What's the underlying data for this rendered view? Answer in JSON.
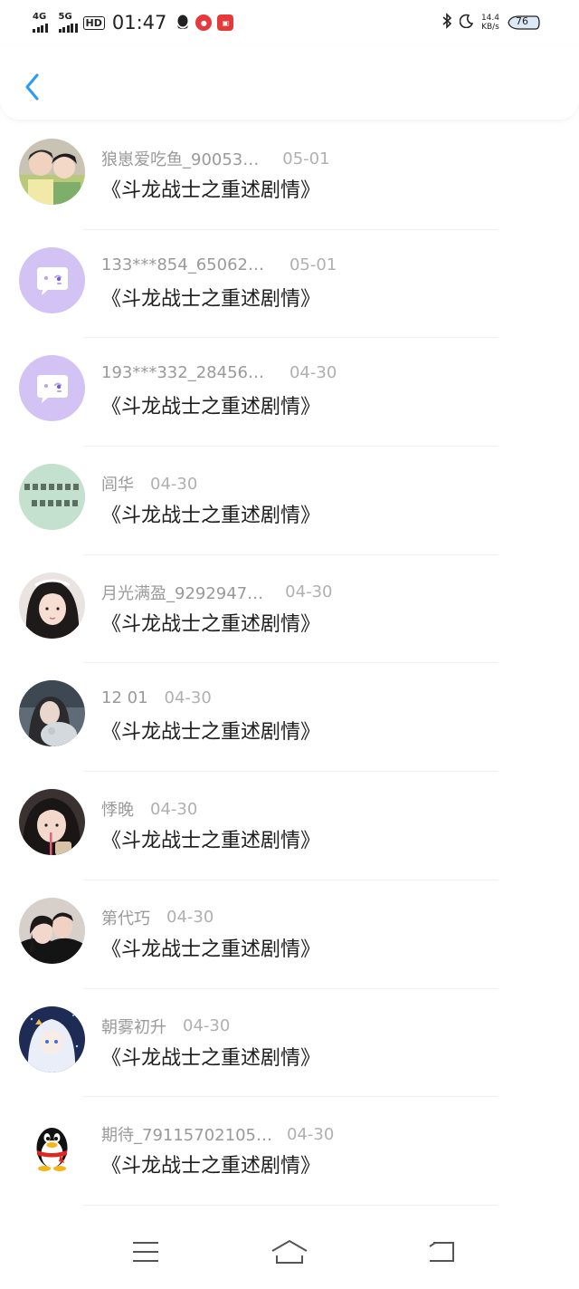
{
  "status_bar": {
    "network_1": "4G",
    "network_2": "5G",
    "hd_label": "HD",
    "time": "01:47",
    "net_speed_value": "14.4",
    "net_speed_unit": "KB/s",
    "battery_level": "76"
  },
  "header": {
    "back_icon": "chevron-left-icon"
  },
  "comments": [
    {
      "username": "狼崽爱吃鱼_90053…",
      "date": "05-01",
      "title": "《斗龙战士之重述剧情》",
      "avatar": "photo-two-boys"
    },
    {
      "username": "133***854_65062…",
      "date": "05-01",
      "title": "《斗龙战士之重述剧情》",
      "avatar": "default-purple-chat"
    },
    {
      "username": "193***332_28456…",
      "date": "04-30",
      "title": "《斗龙战士之重述剧情》",
      "avatar": "default-purple-chat"
    },
    {
      "username": "闾华",
      "date": "04-30",
      "title": "《斗龙战士之重述剧情》",
      "avatar": "green-text-image"
    },
    {
      "username": "月光满盈_9292947…",
      "date": "04-30",
      "title": "《斗龙战士之重述剧情》",
      "avatar": "photo-girl-dark-hair"
    },
    {
      "username": "12 01",
      "date": "04-30",
      "title": "《斗龙战士之重述剧情》",
      "avatar": "photo-girl-with-cat"
    },
    {
      "username": "悸晚",
      "date": "04-30",
      "title": "《斗龙战士之重述剧情》",
      "avatar": "photo-girl-straw"
    },
    {
      "username": "第代巧",
      "date": "04-30",
      "title": "《斗龙战士之重述剧情》",
      "avatar": "photo-couple"
    },
    {
      "username": "朝雾初升",
      "date": "04-30",
      "title": "《斗龙战士之重述剧情》",
      "avatar": "anime-white-hair"
    },
    {
      "username": "期待_79115702105…",
      "date": "04-30",
      "title": "《斗龙战士之重述剧情》",
      "avatar": "qq-penguin"
    }
  ],
  "nav_bar": {
    "menu_icon": "menu-icon",
    "home_icon": "home-icon",
    "back_icon": "back-icon"
  },
  "colors": {
    "accent": "#2b9af3",
    "username_gray": "#9a9a9a",
    "title_dark": "#1e1e1e",
    "default_avatar_purple": "#d3c3f5"
  }
}
